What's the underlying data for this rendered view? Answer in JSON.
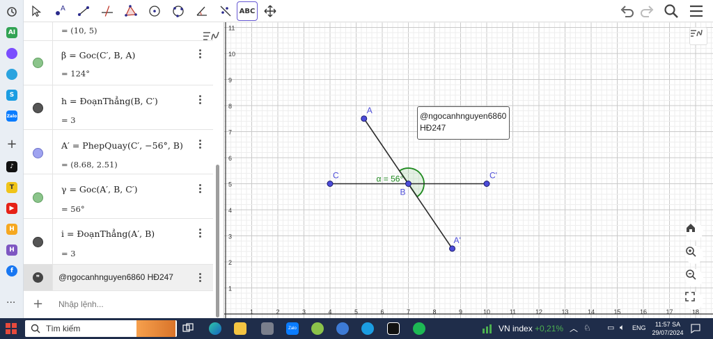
{
  "toolbar": {
    "tools": [
      {
        "name": "move-tool",
        "icon": "arrow-pointer-icon"
      },
      {
        "name": "point-tool",
        "icon": "point-icon"
      },
      {
        "name": "segment-tool",
        "icon": "segment-icon"
      },
      {
        "name": "perpendicular-tool",
        "icon": "perpendicular-line-icon"
      },
      {
        "name": "polygon-tool",
        "icon": "polygon-icon"
      },
      {
        "name": "circle-tool",
        "icon": "circle-center-point-icon"
      },
      {
        "name": "circle-three-points-tool",
        "icon": "circle-three-points-icon"
      },
      {
        "name": "angle-tool",
        "icon": "angle-icon"
      },
      {
        "name": "reflect-tool",
        "icon": "reflect-line-icon"
      },
      {
        "name": "text-tool",
        "icon": "text-icon",
        "label": "ABC"
      },
      {
        "name": "move-graphics-tool",
        "icon": "move-arrows-icon"
      }
    ],
    "right_icons": [
      "undo-icon",
      "redo-icon",
      "search-icon",
      "menu-icon"
    ]
  },
  "algebra": {
    "top_value": "= (10, 5)",
    "items": [
      {
        "name": "beta",
        "def": "β = Goc(C′, B, A)",
        "value": "= 124°",
        "color": "#8bc48b"
      },
      {
        "name": "h",
        "def": "h = ĐoạnThẳng(B, C′)",
        "value": "= 3",
        "color": "#555555"
      },
      {
        "name": "A-prime",
        "def": "A′ = PhepQuay(C′, −56°, B)",
        "value": "= (8.68, 2.51)",
        "color": "#9fa3f0"
      },
      {
        "name": "gamma",
        "def": "γ = Goc(A′, B, C′)",
        "value": "= 56°",
        "color": "#8bc48b"
      },
      {
        "name": "i",
        "def": "i = ĐoạnThẳng(A′, B)",
        "value": "= 3",
        "color": "#555555"
      }
    ],
    "text_item": "@ngocanhnguyen6860 HĐ247",
    "input_placeholder": "Nhập lệnh..."
  },
  "graphics": {
    "x_ticks": [
      "1",
      "2",
      "3",
      "4",
      "5",
      "6",
      "7",
      "8",
      "9",
      "10",
      "11",
      "12",
      "13",
      "14",
      "15",
      "16",
      "17",
      "18"
    ],
    "y_ticks": [
      "1",
      "2",
      "3",
      "4",
      "5",
      "6",
      "7",
      "8",
      "9",
      "10",
      "11"
    ],
    "points": [
      {
        "label": "A",
        "x": 5.3,
        "y": 7.5
      },
      {
        "label": "B",
        "x": 7,
        "y": 5
      },
      {
        "label": "C",
        "x": 4,
        "y": 5
      },
      {
        "label": "C'",
        "x": 10,
        "y": 5
      },
      {
        "label": "A'",
        "x": 8.68,
        "y": 2.51
      }
    ],
    "angle_label": "α = 56°",
    "text_box_lines": [
      "@ngocanhnguyen6860",
      "HĐ247"
    ],
    "point_color": "#4c4cd8",
    "segment_color": "#2b2b2b",
    "angle_color": "#1f8a1f"
  },
  "taskbar": {
    "search_label": "Tìm kiếm",
    "stock_label": "VN index",
    "stock_value": "+0,21%",
    "language": "ENG",
    "time": "11:57 SA",
    "date": "29/07/2024"
  }
}
